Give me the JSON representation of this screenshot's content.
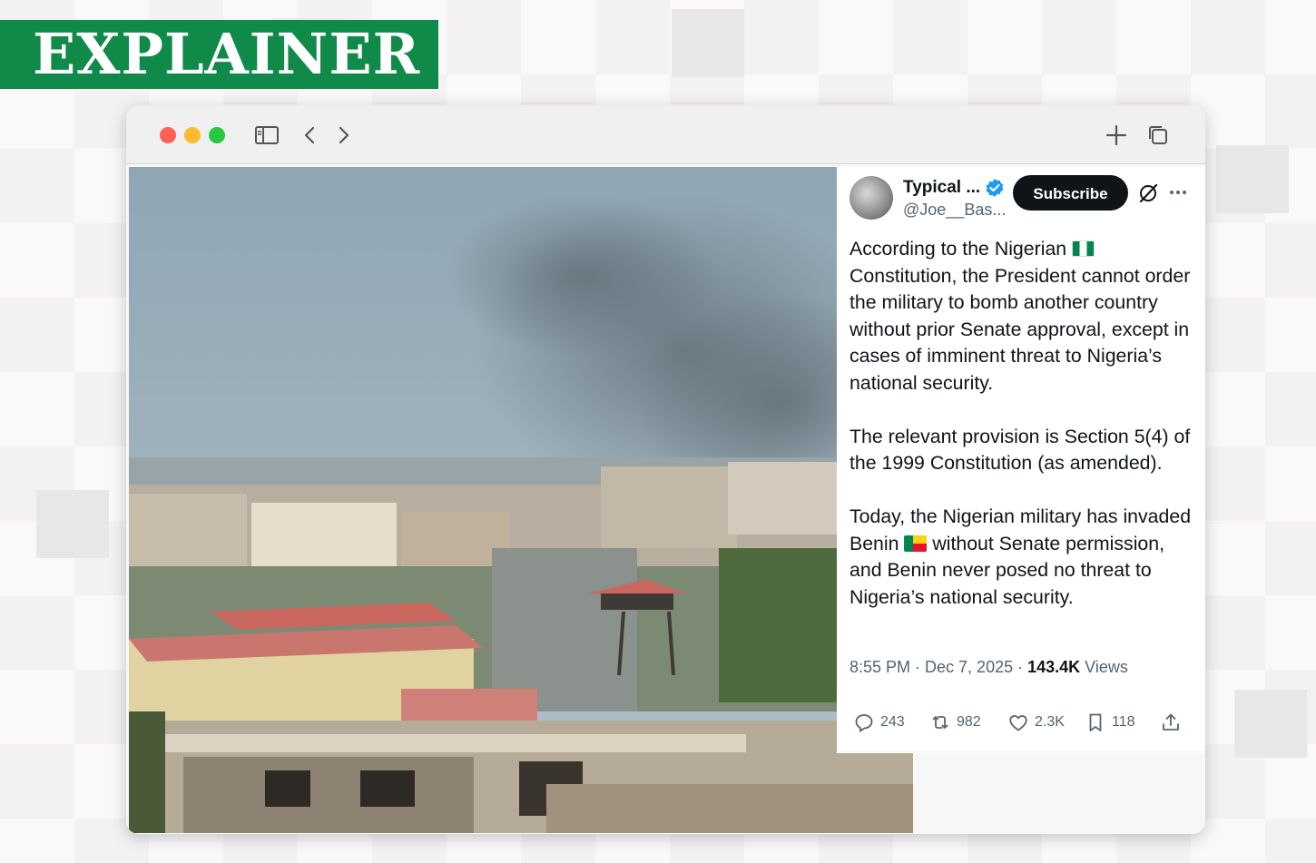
{
  "banner": {
    "label": "EXPLAINER"
  },
  "browser": {
    "icons": [
      "close-dot",
      "minimize-dot",
      "zoom-dot",
      "sidebar-icon",
      "back-icon",
      "forward-icon",
      "new-tab-icon",
      "tab-overview-icon"
    ]
  },
  "tweet": {
    "author_name": "Typical ...",
    "handle": "@Joe__Bas...",
    "subscribe_label": "Subscribe",
    "paragraphs": {
      "p1_a": "According to the Nigerian",
      "p1_b": "Constitution, the President cannot order the military to bomb another country without prior Senate approval, except in cases of imminent threat to Nigeria’s national security.",
      "p2": "The relevant provision is Section 5(4) of the 1999 Constitution (as amended).",
      "p3_a": "Today, the Nigerian military has invaded Benin",
      "p3_b": "without Senate permission, and Benin never posed no threat to Nigeria’s national security."
    },
    "timestamp": "8:55 PM · Dec 7, 2025 · ",
    "views_count": "143.4K",
    "views_label": " Views",
    "actions": {
      "replies": "243",
      "reposts": "982",
      "likes": "2.3K",
      "bookmarks": "118"
    }
  },
  "colors": {
    "banner_green": "#0f8a49",
    "verified_blue": "#1d9bf0",
    "text_primary": "#0f1419",
    "text_secondary": "#536471"
  }
}
